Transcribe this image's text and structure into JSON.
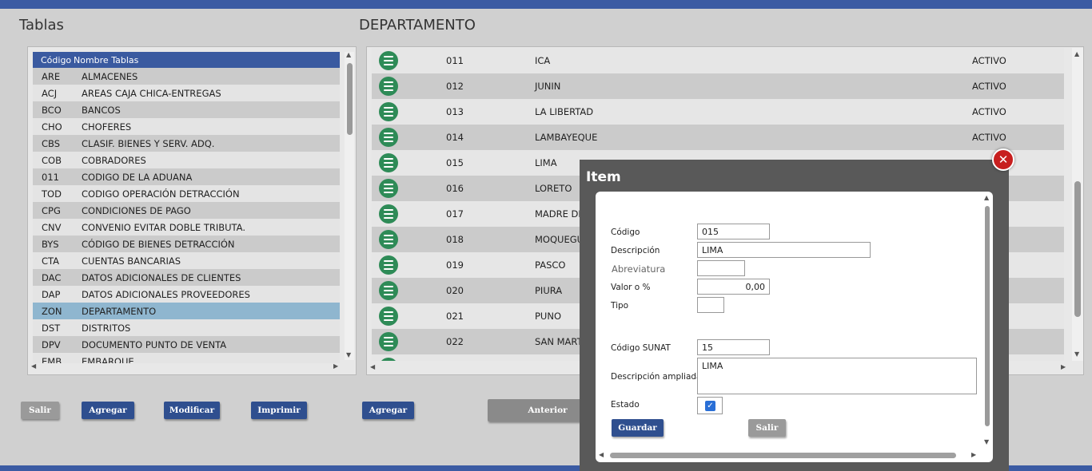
{
  "left_title": "Tablas",
  "right_title": "DEPARTAMENTO",
  "tablas": {
    "headers": [
      "Código",
      "Nombre Tablas"
    ],
    "rows": [
      {
        "code": "ARE",
        "name": "ALMACENES"
      },
      {
        "code": "ACJ",
        "name": "AREAS CAJA CHICA-ENTREGAS"
      },
      {
        "code": "BCO",
        "name": "BANCOS"
      },
      {
        "code": "CHO",
        "name": "CHOFERES"
      },
      {
        "code": "CBS",
        "name": "CLASIF. BIENES Y SERV. ADQ."
      },
      {
        "code": "COB",
        "name": "COBRADORES"
      },
      {
        "code": "011",
        "name": "CODIGO DE LA ADUANA"
      },
      {
        "code": "TOD",
        "name": "CODIGO OPERACIÓN DETRACCIÓN"
      },
      {
        "code": "CPG",
        "name": "CONDICIONES DE PAGO"
      },
      {
        "code": "CNV",
        "name": "CONVENIO EVITAR DOBLE TRIBUTA."
      },
      {
        "code": "BYS",
        "name": "CÓDIGO DE BIENES DETRACCIÓN"
      },
      {
        "code": "CTA",
        "name": "CUENTAS BANCARIAS"
      },
      {
        "code": "DAC",
        "name": "DATOS ADICIONALES DE CLIENTES"
      },
      {
        "code": "DAP",
        "name": "DATOS ADICIONALES PROVEEDORES"
      },
      {
        "code": "ZON",
        "name": "DEPARTAMENTO"
      },
      {
        "code": "DST",
        "name": "DISTRITOS"
      },
      {
        "code": "DPV",
        "name": "DOCUMENTO PUNTO DE VENTA"
      },
      {
        "code": "EMB",
        "name": "EMBARQUE"
      }
    ]
  },
  "departamentos": [
    {
      "code": "011",
      "name": "ICA",
      "status": "ACTIVO"
    },
    {
      "code": "012",
      "name": "JUNIN",
      "status": "ACTIVO"
    },
    {
      "code": "013",
      "name": "LA LIBERTAD",
      "status": "ACTIVO"
    },
    {
      "code": "014",
      "name": "LAMBAYEQUE",
      "status": "ACTIVO"
    },
    {
      "code": "015",
      "name": "LIMA",
      "status": ""
    },
    {
      "code": "016",
      "name": "LORETO",
      "status": ""
    },
    {
      "code": "017",
      "name": "MADRE DE",
      "status": ""
    },
    {
      "code": "018",
      "name": "MOQUEGU",
      "status": ""
    },
    {
      "code": "019",
      "name": "PASCO",
      "status": ""
    },
    {
      "code": "020",
      "name": "PIURA",
      "status": ""
    },
    {
      "code": "021",
      "name": "PUNO",
      "status": ""
    },
    {
      "code": "022",
      "name": "SAN MART",
      "status": ""
    }
  ],
  "buttons": {
    "salir": "Salir",
    "agregar_left": "Agregar",
    "modificar": "Modificar",
    "imprimir": "Imprimir",
    "agregar_right": "Agregar",
    "anterior": "Anterior"
  },
  "modal": {
    "title": "Item",
    "close": "✕",
    "labels": {
      "codigo": "Código",
      "descripcion": "Descripción",
      "abreviatura": "Abreviatura",
      "valor": "Valor o %",
      "tipo": "Tipo",
      "codigo_sunat": "Código SUNAT",
      "descripcion_ampliada": "Descripción ampliada",
      "estado": "Estado"
    },
    "values": {
      "codigo": "015",
      "descripcion": "LIMA",
      "abreviatura": "",
      "valor": "0,00",
      "tipo": "",
      "codigo_sunat": "15",
      "descripcion_ampliada": "LIMA",
      "estado_checked": true
    },
    "guardar": "Guardar",
    "salir": "Salir"
  },
  "colors": {
    "header_blue": "#3a5aa0",
    "selected_row": "#8fb6cf",
    "icon_green": "#2e8b57",
    "close_red": "#c71f1f"
  }
}
